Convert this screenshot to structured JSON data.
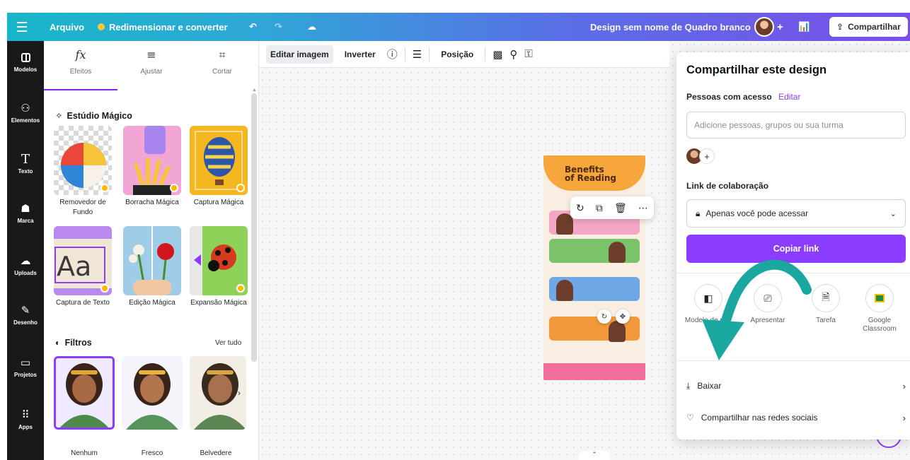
{
  "topbar": {
    "file_label": "Arquivo",
    "resize_label": "Redimensionar e converter",
    "undo_icon": "undo-icon",
    "redo_icon": "redo-icon",
    "cloud_icon": "cloud-save-icon",
    "doc_title": "Design sem nome de Quadro branco",
    "add_label": "+",
    "share_label": "Compartilhar"
  },
  "leftnav": {
    "items": [
      {
        "label": "Modelos",
        "icon": "templates-icon"
      },
      {
        "label": "Elementos",
        "icon": "elements-icon"
      },
      {
        "label": "Texto",
        "icon": "text-icon"
      },
      {
        "label": "Marca",
        "icon": "brand-icon"
      },
      {
        "label": "Uploads",
        "icon": "uploads-icon"
      },
      {
        "label": "Desenho",
        "icon": "draw-icon"
      },
      {
        "label": "Projetos",
        "icon": "projects-icon"
      },
      {
        "label": "Apps",
        "icon": "apps-icon"
      }
    ]
  },
  "panel": {
    "tabs": [
      {
        "label": "Efeitos",
        "icon": "fx"
      },
      {
        "label": "Ajustar",
        "icon": "≡"
      },
      {
        "label": "Cortar",
        "icon": "⌗"
      }
    ],
    "magic_studio": {
      "title": "Estúdio Mágico",
      "tools": [
        {
          "label": "Removedor de Fundo"
        },
        {
          "label": "Borracha Mágica"
        },
        {
          "label": "Captura Mágica"
        },
        {
          "label": "Captura de Texto"
        },
        {
          "label": "Edição Mágica"
        },
        {
          "label": "Expansão Mágica"
        }
      ]
    },
    "filters": {
      "title": "Filtros",
      "see_all": "Ver tudo",
      "items": [
        {
          "label": "Nenhum"
        },
        {
          "label": "Fresco"
        },
        {
          "label": "Belvedere"
        }
      ]
    }
  },
  "toolbar": {
    "edit_image": "Editar imagem",
    "flip": "Inverter",
    "position": "Posição"
  },
  "design": {
    "title_line1": "Benefits",
    "title_line2": "of Reading"
  },
  "share": {
    "title": "Compartilhar este design",
    "access_label": "Pessoas com acesso",
    "edit_label": "Editar",
    "input_placeholder": "Adicione pessoas, grupos ou sua turma",
    "link_label": "Link de colaboração",
    "link_value": "Apenas você pode acessar",
    "copy_link": "Copiar link",
    "options": [
      {
        "label": "Modelo de m...",
        "icon": "template-link-icon"
      },
      {
        "label": "Apresentar",
        "icon": "present-icon"
      },
      {
        "label": "Tarefa",
        "icon": "assignment-icon"
      },
      {
        "label": "Google Classroom",
        "icon": "google-classroom-icon"
      }
    ],
    "rows": [
      {
        "label": "Baixar",
        "icon": "download-icon"
      },
      {
        "label": "Compartilhar nas redes sociais",
        "icon": "social-share-icon"
      }
    ]
  },
  "colors": {
    "accent": "#8b3dff",
    "arrow": "#1aa7a0",
    "topbar_start": "#18b6c9",
    "topbar_end": "#7a4fe8"
  }
}
